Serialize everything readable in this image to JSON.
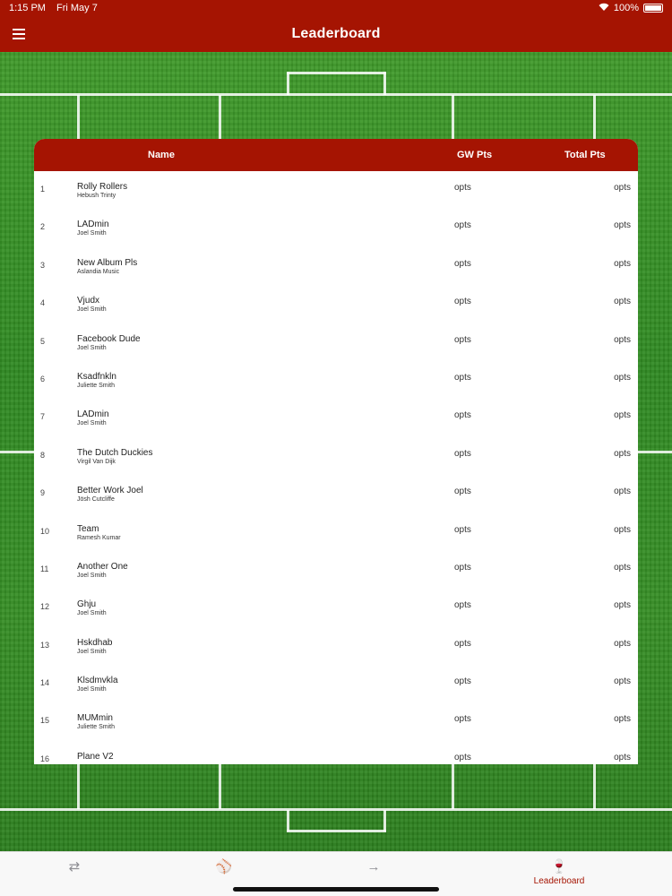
{
  "status": {
    "time": "1:15 PM",
    "date": "Fri May 7",
    "battery": "100%"
  },
  "header": {
    "title": "Leaderboard"
  },
  "table": {
    "col_name": "Name",
    "col_gw": "GW Pts",
    "col_total": "Total Pts",
    "rows": [
      {
        "rank": "1",
        "team": "Rolly Rollers",
        "owner": "Hebush Trinty",
        "gw": "opts",
        "total": "opts"
      },
      {
        "rank": "2",
        "team": "LADmin",
        "owner": "Joel Smith",
        "gw": "opts",
        "total": "opts"
      },
      {
        "rank": "3",
        "team": "New Album Pls",
        "owner": "Aslandia Music",
        "gw": "opts",
        "total": "opts"
      },
      {
        "rank": "4",
        "team": "Vjudx",
        "owner": "Joel Smith",
        "gw": "opts",
        "total": "opts"
      },
      {
        "rank": "5",
        "team": "Facebook Dude",
        "owner": "Joel Smith",
        "gw": "opts",
        "total": "opts"
      },
      {
        "rank": "6",
        "team": "Ksadfnkln",
        "owner": "Juliette Smith",
        "gw": "opts",
        "total": "opts"
      },
      {
        "rank": "7",
        "team": "LADmin",
        "owner": "Joel Smith",
        "gw": "opts",
        "total": "opts"
      },
      {
        "rank": "8",
        "team": "The Dutch Duckies",
        "owner": "Virgil Van Dijk",
        "gw": "opts",
        "total": "opts"
      },
      {
        "rank": "9",
        "team": "Better Work Joel",
        "owner": "Jösh Cutcliffe",
        "gw": "opts",
        "total": "opts"
      },
      {
        "rank": "10",
        "team": "Team",
        "owner": "Ramesh Kumar",
        "gw": "opts",
        "total": "opts"
      },
      {
        "rank": "11",
        "team": "Another One",
        "owner": "Joel Smith",
        "gw": "opts",
        "total": "opts"
      },
      {
        "rank": "12",
        "team": "Ghju",
        "owner": "Joel Smith",
        "gw": "opts",
        "total": "opts"
      },
      {
        "rank": "13",
        "team": "Hskdhab",
        "owner": "Joel Smith",
        "gw": "opts",
        "total": "opts"
      },
      {
        "rank": "14",
        "team": "Klsdmvkla",
        "owner": "Joel Smith",
        "gw": "opts",
        "total": "opts"
      },
      {
        "rank": "15",
        "team": "MUMmin",
        "owner": "Juliette Smith",
        "gw": "opts",
        "total": "opts"
      },
      {
        "rank": "16",
        "team": "Plane V2",
        "owner": "",
        "gw": "opts",
        "total": "opts"
      }
    ]
  },
  "tabbar": {
    "tabs": [
      {
        "name": "transfers-tab",
        "icon": "swap-arrows-icon",
        "glyph": "⇄",
        "label": ""
      },
      {
        "name": "fixtures-tab",
        "icon": "ball-icon",
        "glyph": "⚾",
        "label": ""
      },
      {
        "name": "next-tab",
        "icon": "arrow-right-icon",
        "glyph": "→",
        "label": ""
      },
      {
        "name": "leaderboard-tab",
        "icon": "trophy-cup-icon",
        "glyph": "🍷",
        "label": "Leaderboard"
      }
    ]
  },
  "colors": {
    "brand": "#a51402",
    "pitch": "#2f8a22"
  }
}
